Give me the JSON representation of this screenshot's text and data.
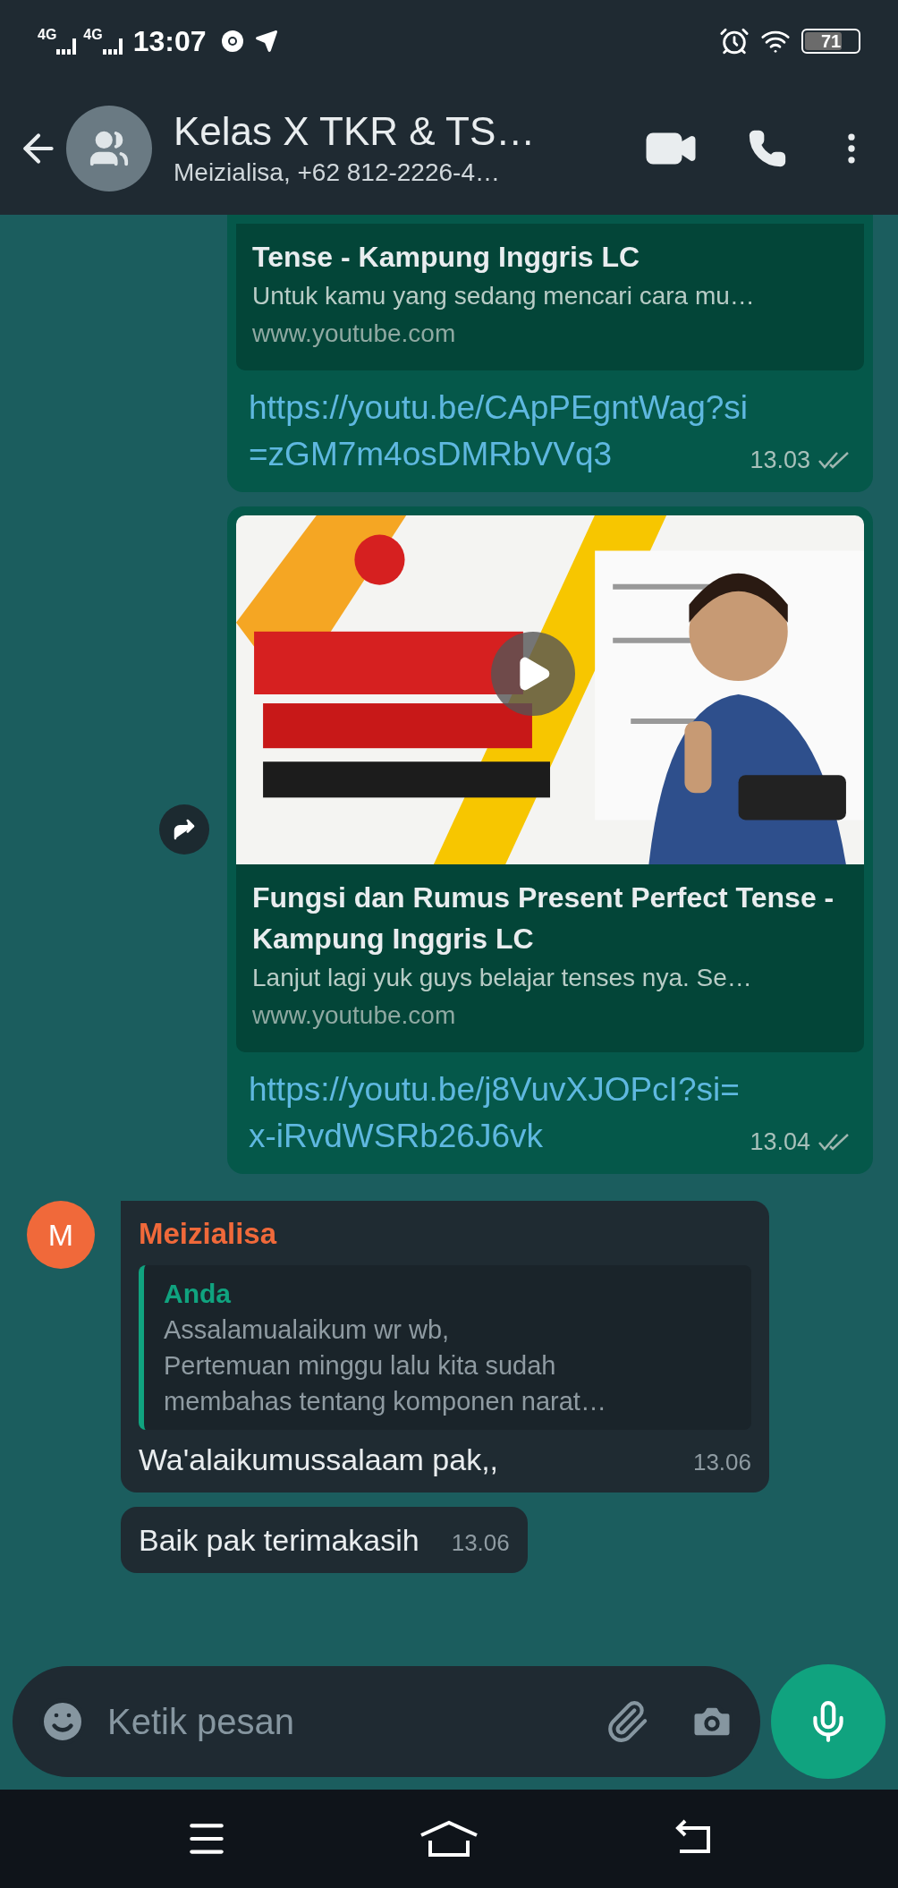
{
  "status_bar": {
    "signal_1": "4G",
    "signal_2": "4G",
    "time": "13:07",
    "battery": "71"
  },
  "header": {
    "title": "Kelas X TKR & TS…",
    "subtitle": "Meizialisa, +62 812-2226-4…"
  },
  "messages": [
    {
      "kind": "link",
      "outgoing": true,
      "cut_top": true,
      "preview": {
        "title": "Tense - Kampung Inggris LC",
        "description": "Untuk kamu yang sedang mencari cara mu…",
        "domain": "www.youtube.com"
      },
      "text": "https://youtu.be/CApPEgntWag?si=zGM7m4osDMRbVVq3",
      "time": "13.03",
      "read": false
    },
    {
      "kind": "link",
      "outgoing": true,
      "cut_top": false,
      "forward": true,
      "preview": {
        "title": "Fungsi dan Rumus Present Perfect Tense - Kampung Inggris LC",
        "description": "Lanjut lagi yuk guys belajar tenses nya. Se…",
        "domain": "www.youtube.com"
      },
      "text": "https://youtu.be/j8VuvXJOPcI?si=x-iRvdWSRb26J6vk",
      "time": "13.04",
      "read": false
    },
    {
      "kind": "reply",
      "outgoing": false,
      "avatar": "M",
      "sender": "Meizialisa",
      "color": "#f0693a",
      "quote": {
        "author": "Anda",
        "lines": [
          "Assalamualaikum wr wb,",
          "Pertemuan minggu lalu kita sudah",
          "membahas tentang komponen narat…"
        ]
      },
      "text": "Wa'alaikumussalaam pak,,",
      "time": "13.06"
    },
    {
      "kind": "text",
      "outgoing": false,
      "text": "Baik pak terimakasih",
      "time": "13.06"
    }
  ],
  "composer": {
    "placeholder": "Ketik pesan"
  }
}
